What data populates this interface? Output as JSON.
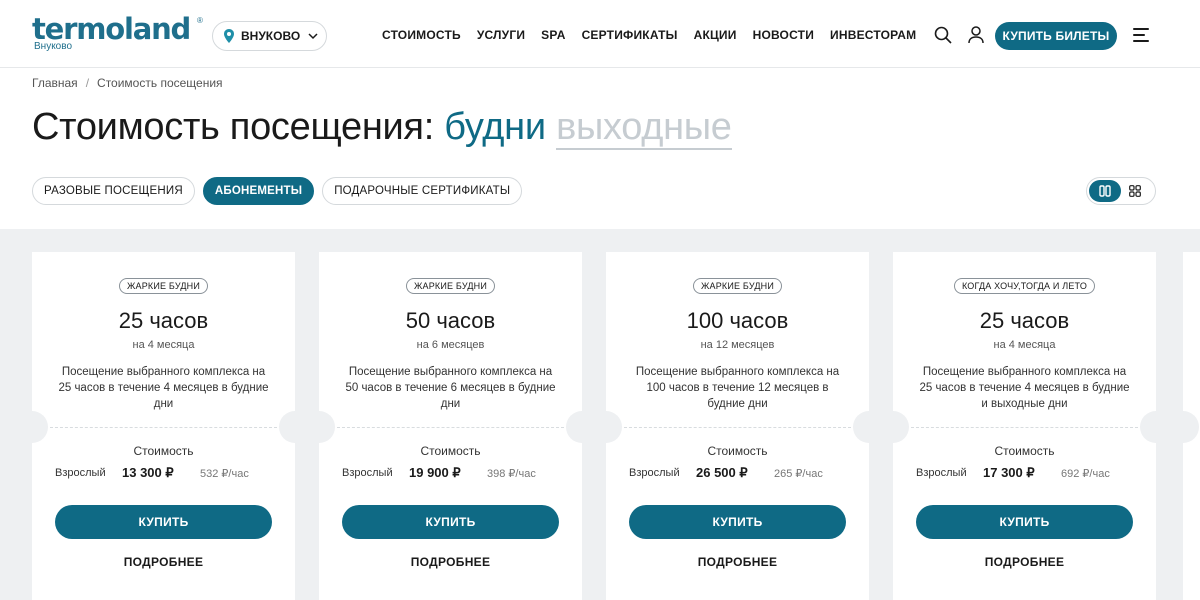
{
  "header": {
    "logo": "termoland",
    "logo_sub": "Внуково",
    "location": "ВНУКОВО",
    "nav": [
      "СТОИМОСТЬ",
      "УСЛУГИ",
      "SPA",
      "СЕРТИФИКАТЫ",
      "АКЦИИ",
      "НОВОСТИ",
      "ИНВЕСТОРАМ"
    ],
    "buy_label": "КУПИТЬ БИЛЕТЫ"
  },
  "breadcrumb": {
    "home": "Главная",
    "separator": "/",
    "current": "Стоимость посещения"
  },
  "title": {
    "prefix": "Стоимость посещения:",
    "active": "будни",
    "inactive": "выходные"
  },
  "tabs": [
    "РАЗОВЫЕ ПОСЕЩЕНИЯ",
    "АБОНЕМЕНТЫ",
    "ПОДАРОЧНЫЕ СЕРТИФИКАТЫ"
  ],
  "selected_tab": "АБОНЕМЕНТЫ",
  "cards": [
    {
      "tag": "ЖАРКИЕ БУДНИ",
      "hours": "25 часов",
      "period": "на 4 месяца",
      "description": "Посещение выбранного комплекса на 25 часов в течение 4 месяцев в будние дни",
      "cost_label": "Стоимость",
      "adult_label": "Взрослый",
      "price": "13 300 ₽",
      "per_hour": "532 ₽/час",
      "buy_label": "КУПИТЬ",
      "more_label": "ПОДРОБНЕЕ"
    },
    {
      "tag": "ЖАРКИЕ БУДНИ",
      "hours": "50 часов",
      "period": "на 6 месяцев",
      "description": "Посещение выбранного комплекса на 50 часов в течение 6 месяцев в будние дни",
      "cost_label": "Стоимость",
      "adult_label": "Взрослый",
      "price": "19 900 ₽",
      "per_hour": "398 ₽/час",
      "buy_label": "КУПИТЬ",
      "more_label": "ПОДРОБНЕЕ"
    },
    {
      "tag": "ЖАРКИЕ БУДНИ",
      "hours": "100 часов",
      "period": "на 12 месяцев",
      "description": "Посещение выбранного комплекса на 100 часов в течение 12 месяцев в будние дни",
      "cost_label": "Стоимость",
      "adult_label": "Взрослый",
      "price": "26 500 ₽",
      "per_hour": "265 ₽/час",
      "buy_label": "КУПИТЬ",
      "more_label": "ПОДРОБНЕЕ"
    },
    {
      "tag": "КОГДА ХОЧУ,ТОГДА И ЛЕТО",
      "hours": "25 часов",
      "period": "на 4 месяца",
      "description": "Посещение выбранного комплекса на 25 часов в течение 4 месяцев в будние и выходные дни",
      "cost_label": "Стоимость",
      "adult_label": "Взрослый",
      "price": "17 300 ₽",
      "per_hour": "692 ₽/час",
      "buy_label": "КУПИТЬ",
      "more_label": "ПОДРОБНЕЕ"
    }
  ],
  "colors": {
    "accent": "#0f6a85",
    "background_band": "#eef0f2",
    "inactive_text": "#c6ccd1"
  },
  "icons": [
    "location-pin-icon",
    "chevron-down-icon",
    "search-icon",
    "user-icon",
    "menu-icon",
    "list-view-icon",
    "grid-view-icon"
  ]
}
